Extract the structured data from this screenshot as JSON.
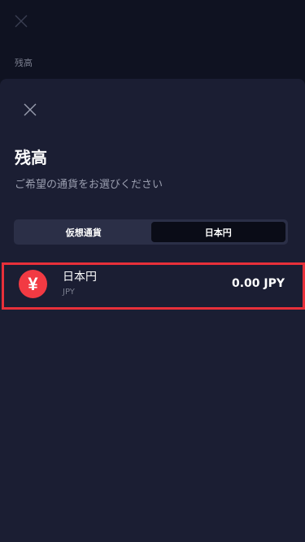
{
  "background_page": {
    "title": "残高"
  },
  "sheet": {
    "title": "残高",
    "subtitle": "ご希望の通貨をお選びください",
    "tabs": [
      {
        "label": "仮想通貨",
        "active": false
      },
      {
        "label": "日本円",
        "active": true
      }
    ],
    "currencies": [
      {
        "name": "日本円",
        "code": "JPY",
        "balance": "0.00 JPY",
        "icon": "yen-icon",
        "icon_glyph": "¥",
        "icon_color": "#f23a43",
        "selected": true
      }
    ]
  },
  "colors": {
    "background": "#0f1221",
    "sheet": "#1b1e33",
    "highlight_border": "#e8303a"
  }
}
